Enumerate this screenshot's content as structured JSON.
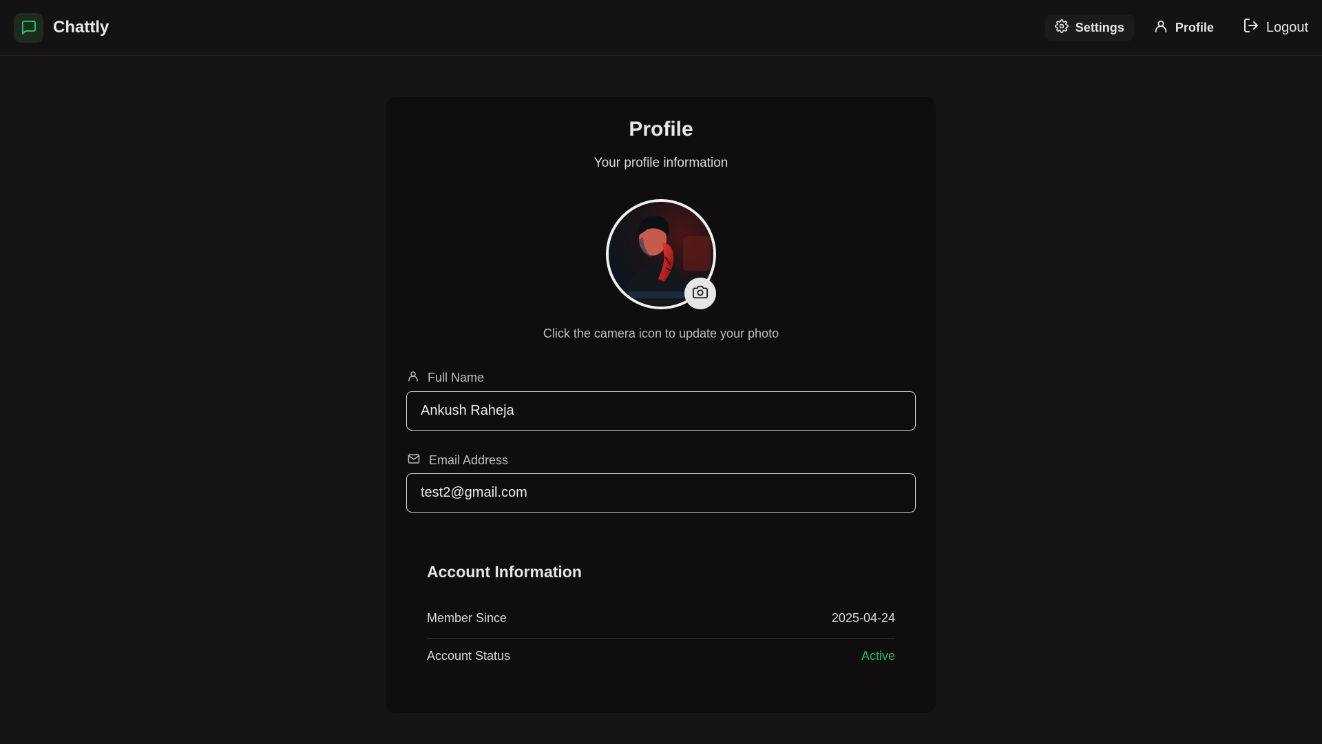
{
  "app": {
    "name": "Chattly"
  },
  "nav": {
    "settings": "Settings",
    "profile": "Profile",
    "logout": "Logout"
  },
  "profile": {
    "title": "Profile",
    "subtitle": "Your profile information",
    "hint": "Click the camera icon to update your photo",
    "full_name_label": "Full Name",
    "full_name_value": "Ankush Raheja",
    "email_label": "Email Address",
    "email_value": "test2@gmail.com"
  },
  "account": {
    "title": "Account Information",
    "member_since_label": "Member Since",
    "member_since_value": "2025-04-24",
    "status_label": "Account Status",
    "status_value": "Active"
  },
  "colors": {
    "background": "#161414",
    "card": "#0f0d0d",
    "brand_accent": "#1fbf55",
    "status_active": "#1fbf55"
  },
  "icons": {
    "brand": "message-square-icon",
    "settings": "gear-icon",
    "profile": "user-icon",
    "logout": "logout-icon",
    "camera": "camera-icon",
    "full_name": "user-icon",
    "email": "mail-icon"
  }
}
